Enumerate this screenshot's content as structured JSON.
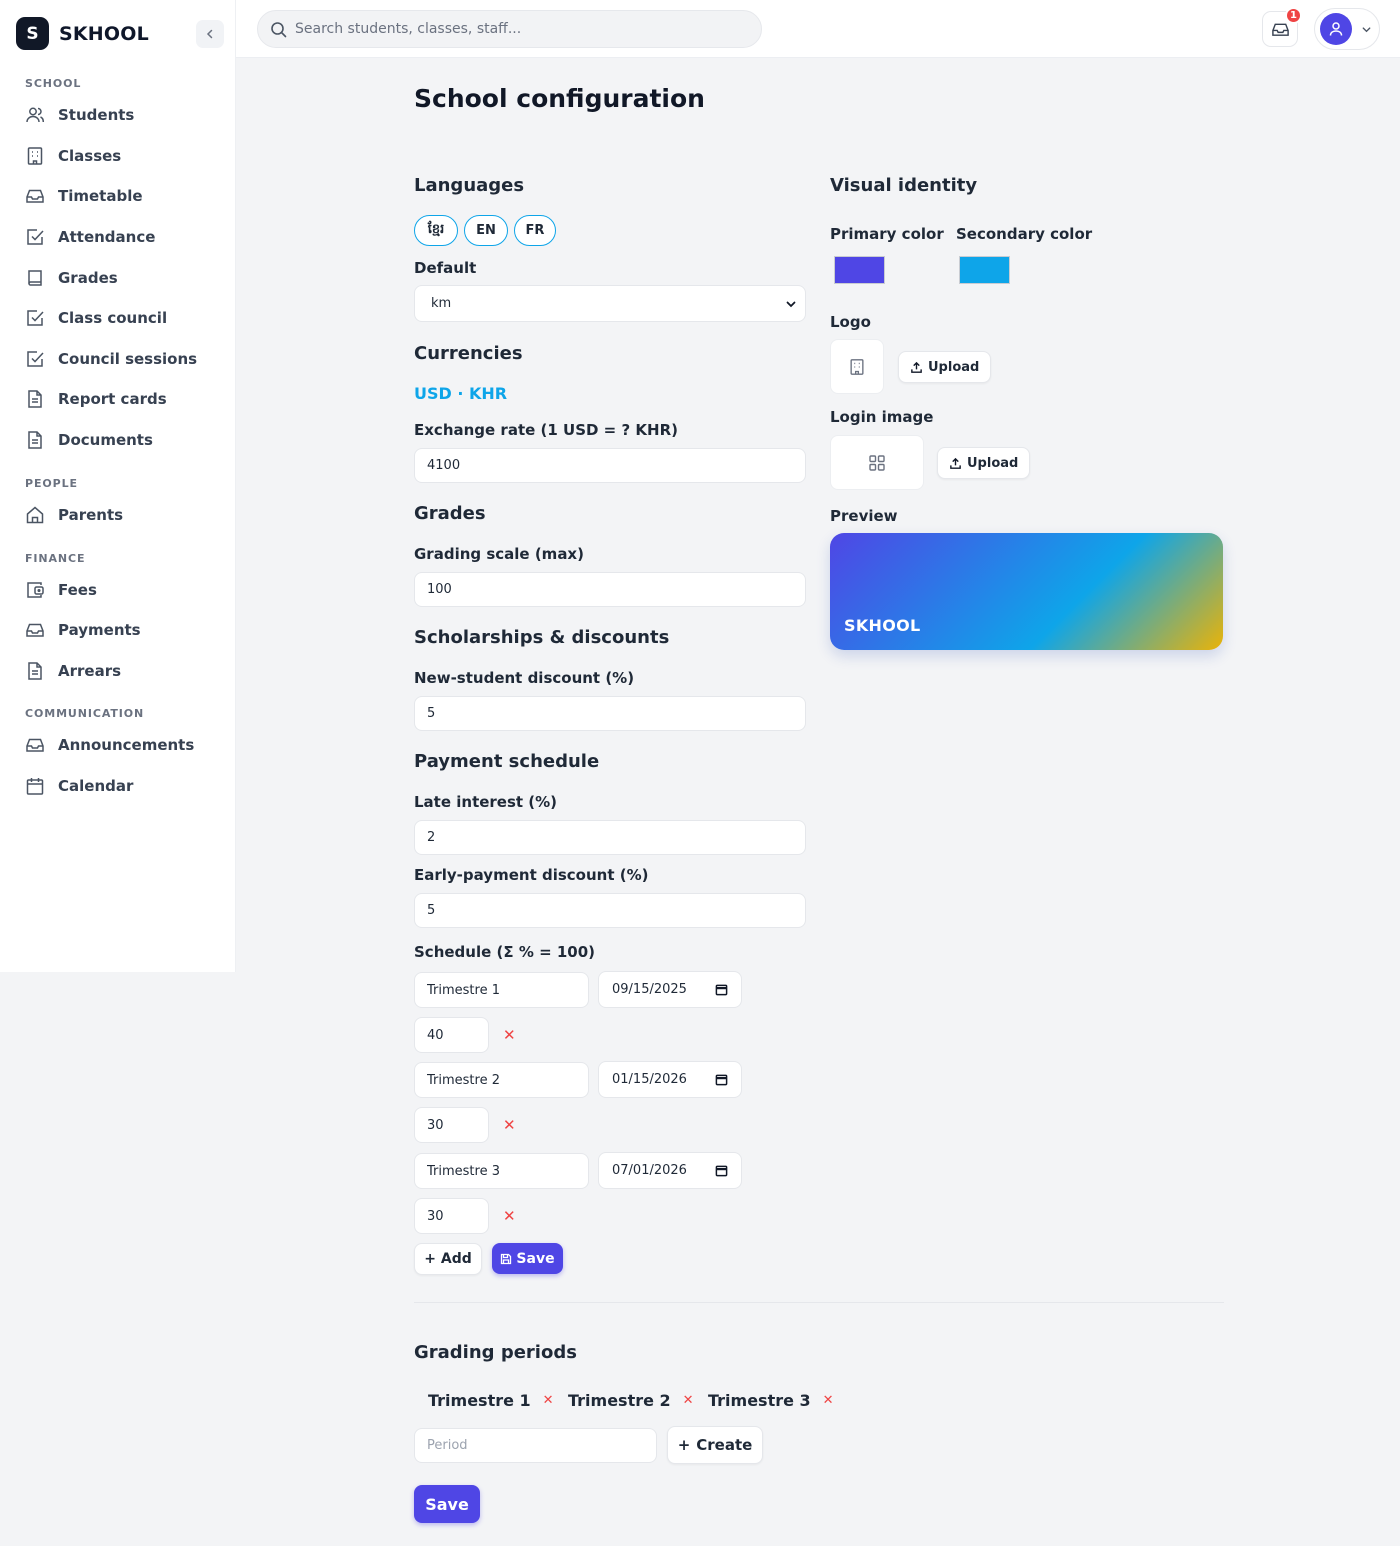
{
  "brand": {
    "initial": "S",
    "name": "SKHOOL"
  },
  "sidebar": {
    "sections": [
      {
        "title": "SCHOOL",
        "items": [
          {
            "label": "Students",
            "icon": "users-icon"
          },
          {
            "label": "Classes",
            "icon": "building-icon"
          },
          {
            "label": "Timetable",
            "icon": "inbox-icon"
          },
          {
            "label": "Attendance",
            "icon": "check-square-icon"
          },
          {
            "label": "Grades",
            "icon": "book-icon"
          },
          {
            "label": "Class council",
            "icon": "check-square-icon"
          },
          {
            "label": "Council sessions",
            "icon": "check-square-icon"
          },
          {
            "label": "Report cards",
            "icon": "document-icon"
          },
          {
            "label": "Documents",
            "icon": "document-icon"
          }
        ]
      },
      {
        "title": "PEOPLE",
        "items": [
          {
            "label": "Parents",
            "icon": "home-icon"
          }
        ]
      },
      {
        "title": "FINANCE",
        "items": [
          {
            "label": "Fees",
            "icon": "wallet-icon"
          },
          {
            "label": "Payments",
            "icon": "inbox-icon"
          },
          {
            "label": "Arrears",
            "icon": "document-icon"
          }
        ]
      },
      {
        "title": "COMMUNICATION",
        "items": [
          {
            "label": "Announcements",
            "icon": "inbox-icon"
          },
          {
            "label": "Calendar",
            "icon": "calendar-icon"
          }
        ]
      }
    ]
  },
  "topbar": {
    "search_placeholder": "Search students, classes, staff...",
    "notification_count": "1"
  },
  "page": {
    "title": "School configuration"
  },
  "languages": {
    "title": "Languages",
    "options": [
      "ខ្មែរ",
      "EN",
      "FR"
    ],
    "default_label": "Default",
    "default_value": "km"
  },
  "currencies": {
    "title": "Currencies",
    "value": "USD · KHR",
    "exchange_label": "Exchange rate (1 USD = ? KHR)",
    "exchange_value": "4100"
  },
  "grades": {
    "title": "Grades",
    "scale_label": "Grading scale (max)",
    "scale_value": "100"
  },
  "scholarships": {
    "title": "Scholarships & discounts",
    "new_student_label": "New-student discount (%)",
    "new_student_value": "5"
  },
  "payment_schedule": {
    "title": "Payment schedule",
    "late_label": "Late interest (%)",
    "late_value": "2",
    "early_label": "Early-payment discount (%)",
    "early_value": "5",
    "schedule_label": "Schedule (Σ % = 100)",
    "rows": [
      {
        "name": "Trimestre 1",
        "date": "09/15/2025",
        "percent": "40"
      },
      {
        "name": "Trimestre 2",
        "date": "01/15/2026",
        "percent": "30"
      },
      {
        "name": "Trimestre 3",
        "date": "07/01/2026",
        "percent": "30"
      }
    ],
    "add_label": "Add",
    "save_label": "Save"
  },
  "visual_identity": {
    "title": "Visual identity",
    "primary_label": "Primary color",
    "primary_color": "#4f46e5",
    "secondary_label": "Secondary color",
    "secondary_color": "#0ea5e9",
    "logo_label": "Logo",
    "login_image_label": "Login image",
    "upload_label": "Upload",
    "preview_label": "Preview",
    "preview_name": "SKHOOL"
  },
  "grading_periods": {
    "title": "Grading periods",
    "periods": [
      "Trimestre 1",
      "Trimestre 2",
      "Trimestre 3"
    ],
    "input_placeholder": "Period",
    "create_label": "Create",
    "save_label": "Save"
  }
}
